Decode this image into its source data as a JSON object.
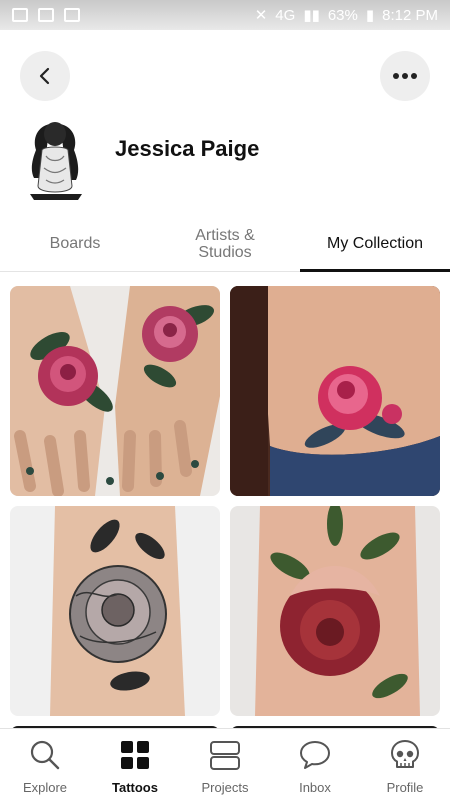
{
  "status_bar": {
    "network": "4G",
    "battery": "63%",
    "time": "8:12 PM"
  },
  "header": {
    "back_icon": "chevron-left-icon",
    "more_icon": "more-dots-icon"
  },
  "profile": {
    "name": "Jessica Paige"
  },
  "tabs": [
    {
      "label": "Boards",
      "active": false
    },
    {
      "label": "Artists & Studios",
      "active": false
    },
    {
      "label": "My Collection",
      "active": true
    }
  ],
  "collection": [
    {
      "subject": "hand peony tattoos",
      "accent": "#b2335a"
    },
    {
      "subject": "hip peony tattoo",
      "accent": "#d0305f"
    },
    {
      "subject": "black and grey peony forearm tattoo",
      "accent": "#6b6b6b"
    },
    {
      "subject": "red peony leg tattoo",
      "accent": "#8e2330"
    }
  ],
  "bottom_nav": [
    {
      "label": "Explore",
      "icon": "search-icon",
      "active": false
    },
    {
      "label": "Tattoos",
      "icon": "grid-icon",
      "active": true
    },
    {
      "label": "Projects",
      "icon": "projects-icon",
      "active": false
    },
    {
      "label": "Inbox",
      "icon": "chat-bubble-icon",
      "active": false
    },
    {
      "label": "Profile",
      "icon": "skull-icon",
      "active": false
    }
  ],
  "colors": {
    "active_text": "#111111",
    "inactive_text": "#777777",
    "button_bg": "#eeeeee"
  }
}
